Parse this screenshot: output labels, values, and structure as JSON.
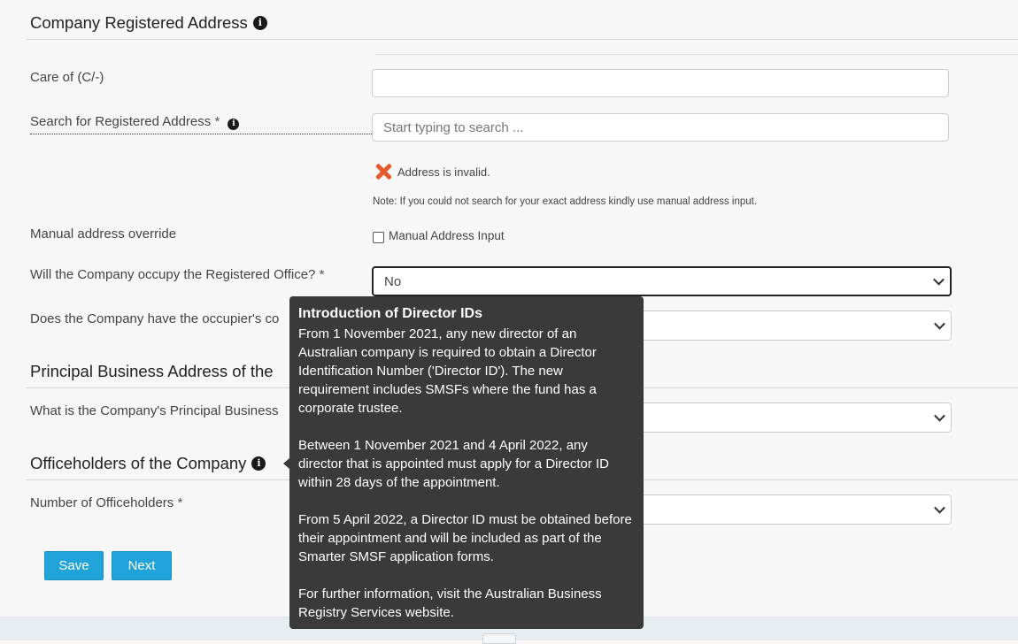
{
  "sections": {
    "registered_address": "Company Registered Address",
    "principal_business": "Principal Business Address of the",
    "officeholders": "Officeholders of the Company"
  },
  "fields": {
    "care_of": {
      "label": "Care of (C/-)",
      "value": ""
    },
    "search_address": {
      "label": "Search for Registered Address",
      "required": "*",
      "placeholder": "Start typing to search ..."
    },
    "invalid_message": "Address is invalid.",
    "note": "Note: If you could not search for your exact address kindly use manual address input.",
    "manual_override": {
      "label": "Manual address override",
      "checkbox_label": "Manual Address Input",
      "checked": false
    },
    "occupy_office": {
      "label": "Will the Company occupy the Registered Office?",
      "required": "*",
      "value": "No"
    },
    "occupier_consent": {
      "label": "Does the Company have the occupier's co",
      "value": ""
    },
    "principal_place": {
      "label": "What is the Company's Principal Business",
      "value": ""
    },
    "num_officeholders": {
      "label": "Number of Officeholders",
      "required": "*",
      "value": ""
    }
  },
  "buttons": {
    "save": "Save",
    "next": "Next"
  },
  "tooltip": {
    "title": "Introduction of Director IDs",
    "paragraphs": [
      "From 1 November 2021, any new director of an Australian company is required to obtain a Director Identification Number ('Director ID'). The new requirement includes SMSFs where the fund has a corporate trustee.",
      "Between 1 November 2021 and 4 April 2022, any director that is appointed must apply for a Director ID within 28 days of the appointment.",
      "From 5 April 2022, a Director ID must be obtained before their appointment and will be included as part of the Smarter SMSF application forms.",
      "For further information, visit the Australian Business Registry Services website."
    ]
  },
  "icons": {
    "info": "info-icon",
    "invalid": "x-icon",
    "dropdown": "chevron-down-icon"
  }
}
